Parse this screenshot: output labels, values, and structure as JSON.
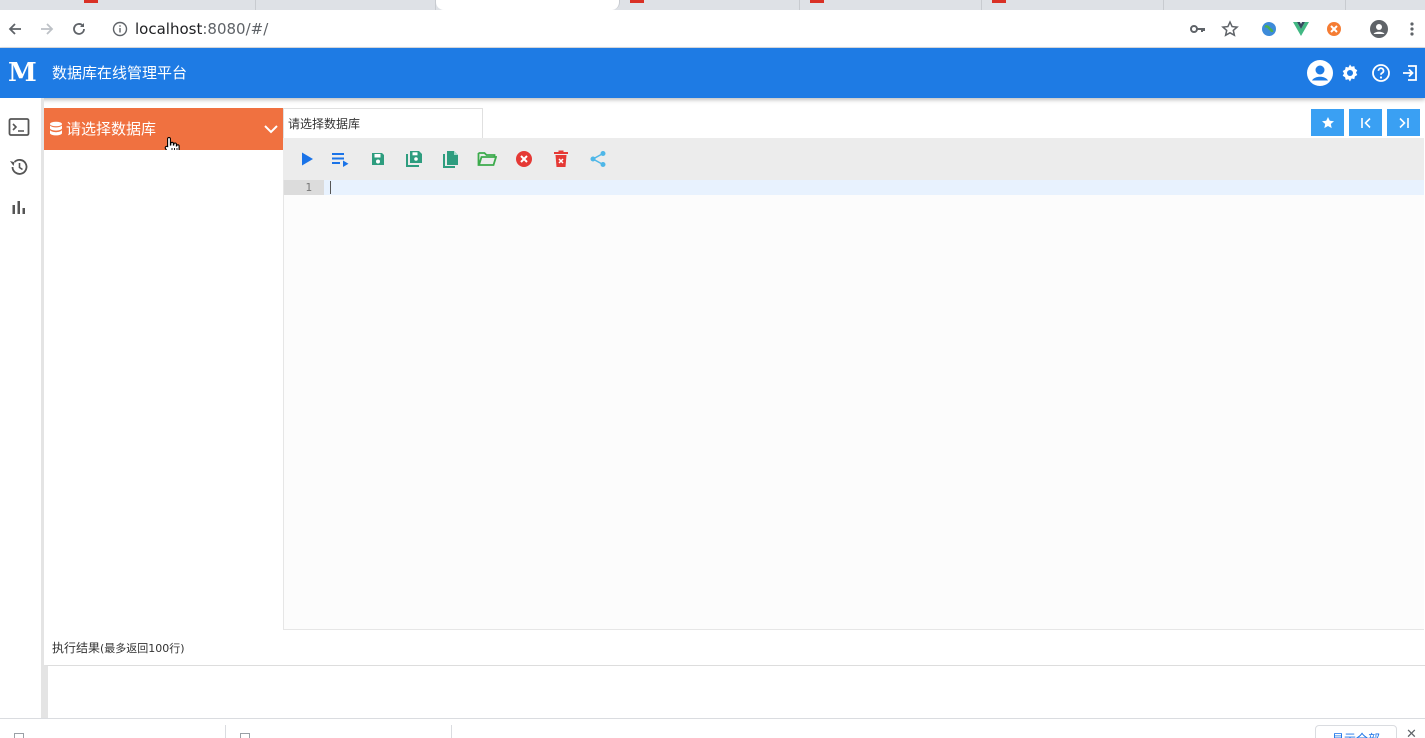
{
  "browser": {
    "url_host": "localhost",
    "url_rest": ":8080/#/"
  },
  "header": {
    "logo": "M",
    "title": "数据库在线管理平台"
  },
  "db_panel": {
    "select_label": "请选择数据库"
  },
  "editor": {
    "tab_label": "请选择数据库",
    "line_number": "1"
  },
  "results": {
    "title": "执行结果",
    "subtitle": "(最多返回100行)"
  },
  "downloads": {
    "show_all": "显示全部"
  },
  "colors": {
    "brand": "#1e7be4",
    "accent": "#f07140",
    "button": "#3aa0f3"
  }
}
